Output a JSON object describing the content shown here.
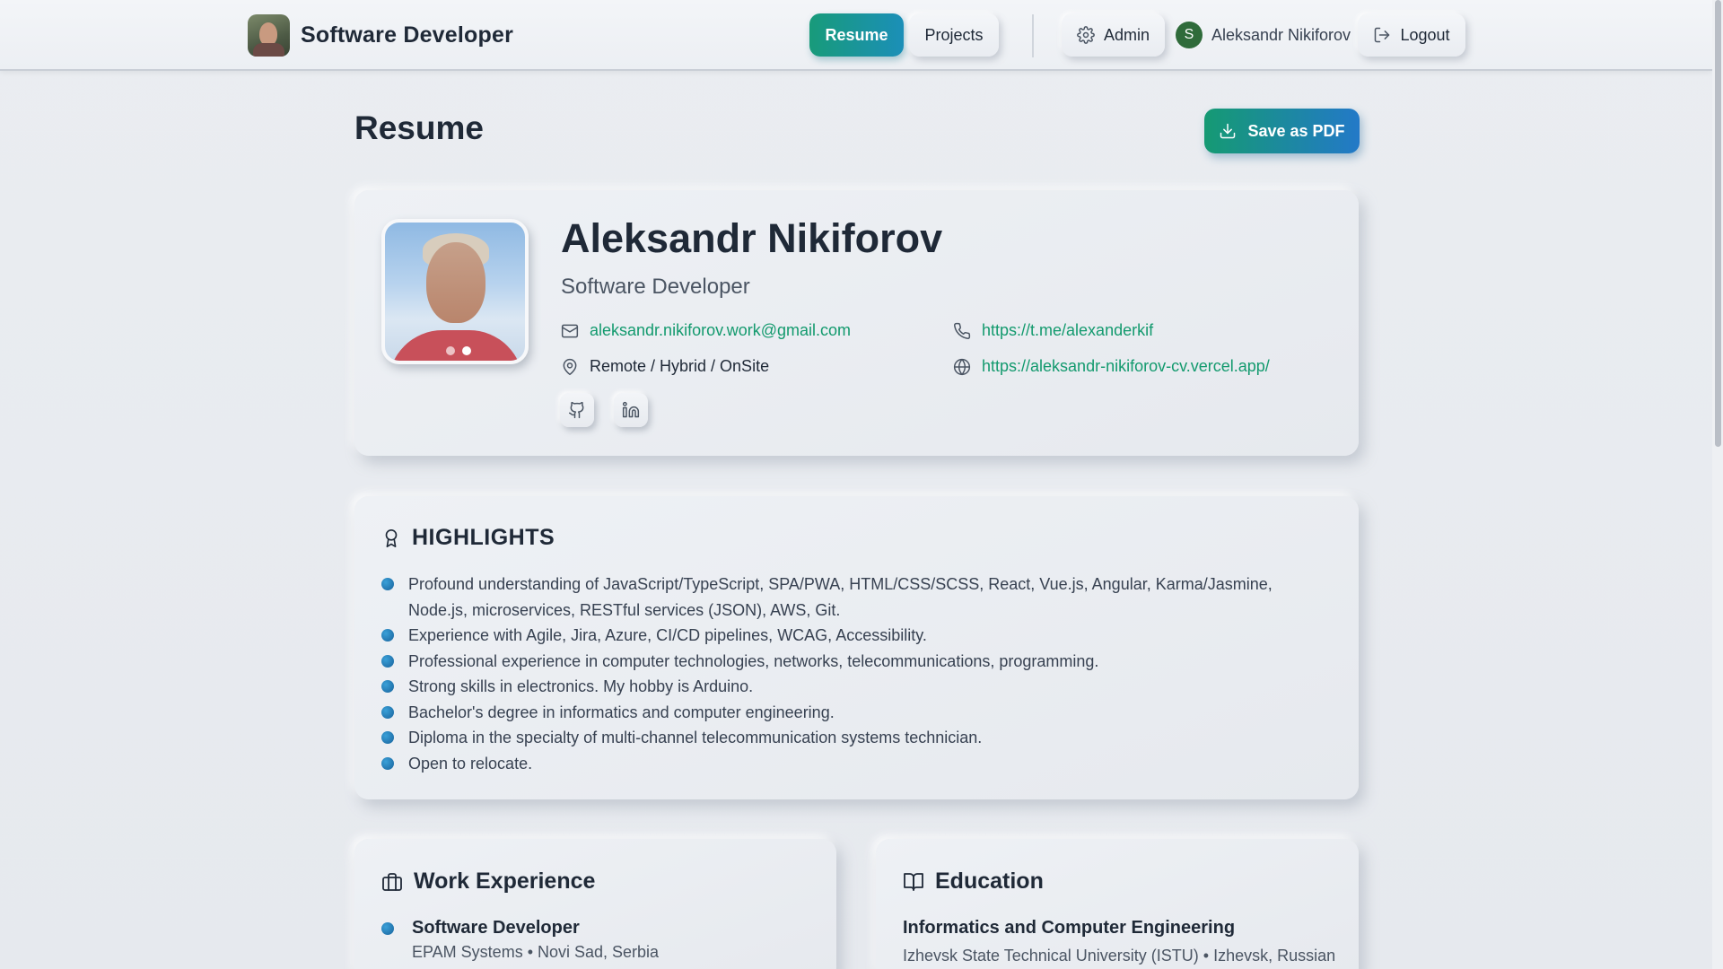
{
  "header": {
    "brand_title": "Software Developer",
    "nav": {
      "resume": "Resume",
      "projects": "Projects",
      "admin": "Admin",
      "logout": "Logout"
    },
    "user": {
      "initial": "S",
      "name": "Aleksandr Nikiforov"
    }
  },
  "page": {
    "title": "Resume",
    "save_pdf_label": "Save as PDF"
  },
  "profile": {
    "name": "Aleksandr Nikiforov",
    "role": "Software Developer",
    "email": "aleksandr.nikiforov.work@gmail.com",
    "location": "Remote / Hybrid / OnSite",
    "telegram": "https://t.me/alexanderkif",
    "website": "https://aleksandr-nikiforov-cv.vercel.app/",
    "photo_slide": {
      "current": 2,
      "total": 2
    }
  },
  "highlights": {
    "title": "HIGHLIGHTS",
    "items": [
      "Profound understanding of JavaScript/TypeScript, SPA/PWA, HTML/CSS/SCSS, React, Vue.js, Angular, Karma/Jasmine, Node.js, microservices, RESTful services (JSON), AWS, Git.",
      "Experience with Agile, Jira, Azure, CI/CD pipelines, WCAG, Accessibility.",
      "Professional experience in computer technologies, networks, telecommunications, programming.",
      "Strong skills in electronics. My hobby is Arduino.",
      "Bachelor's degree in informatics and computer engineering.",
      "Diploma in the specialty of multi-channel telecommunication systems technician.",
      "Open to relocate."
    ]
  },
  "work": {
    "title": "Work Experience",
    "items": [
      {
        "position": "Software Developer",
        "company": "EPAM Systems • Novi Sad, Serbia"
      }
    ]
  },
  "education": {
    "title": "Education",
    "items": [
      {
        "degree": "Informatics and Computer Engineering",
        "school": "Izhevsk State Technical University (ISTU) • Izhevsk, Russian Federation"
      }
    ]
  },
  "colors": {
    "accent_green": "#139a6e",
    "accent_blue": "#2379c8",
    "bullet": "#1f6fa8"
  },
  "icons": {
    "email": "mail-icon",
    "phone": "phone-icon",
    "location": "map-pin-icon",
    "website": "globe-icon",
    "github": "github-icon",
    "linkedin": "linkedin-icon",
    "highlights": "award-icon",
    "work": "briefcase-icon",
    "education": "book-open-icon",
    "admin": "gear-icon",
    "logout": "logout-icon",
    "save": "download-icon"
  }
}
